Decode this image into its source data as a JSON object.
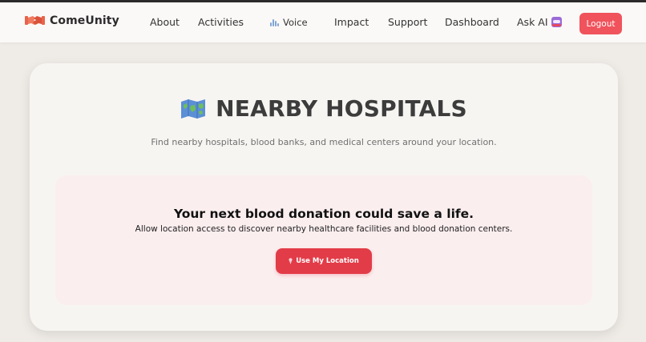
{
  "navbar": {
    "brand_name": "ComeUnity",
    "brand_logo_icon": "handshake-icon",
    "items": [
      {
        "label": "About"
      },
      {
        "label": "Activities"
      },
      {
        "label": "Voice",
        "icon": "sound-wave-icon"
      },
      {
        "label": "Impact"
      },
      {
        "label": "Support"
      },
      {
        "label": "Dashboard"
      },
      {
        "label": "Ask AI",
        "icon": "robot-icon"
      }
    ],
    "logout_label": "Logout"
  },
  "main": {
    "title_icon": "world-map-icon",
    "title": "NEARBY HOSPITALS",
    "subtitle": "Find nearby hospitals, blood banks, and medical centers around your location.",
    "panel": {
      "heading": "Your next blood donation could save a life.",
      "text": "Allow location access to discover nearby healthcare facilities and blood donation centers.",
      "button_label": "Use My Location",
      "button_icon": "location-pin-icon"
    }
  },
  "colors": {
    "accent": "#e23c48",
    "logout": "#f0535c",
    "page_background": "#efebe6",
    "panel_background": "#fbeeef"
  }
}
